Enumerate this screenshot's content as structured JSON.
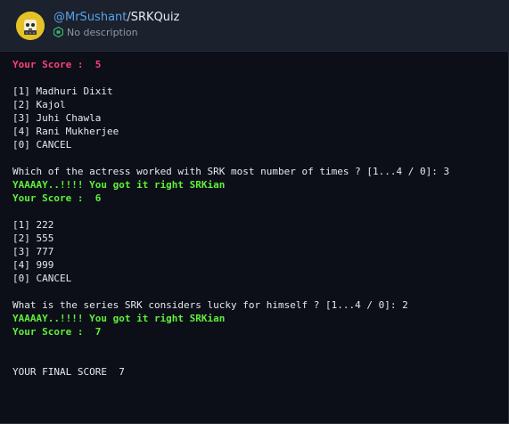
{
  "header": {
    "owner": "@MrSushant",
    "slash": "/",
    "repo": "SRKQuiz",
    "description": "No description",
    "avatar_icon": "robot-face-avatar",
    "repl_icon": "hexagon-repl-icon"
  },
  "colors": {
    "background": "#0c0f18",
    "header_bg": "#1b212d",
    "score_red": "#ff3f7a",
    "success_green": "#5ff03a",
    "link_blue": "#5aa0e8"
  },
  "console": {
    "score_line_1": "Your Score :  5",
    "options_1": [
      "[1] Madhuri Dixit",
      "[2] Kajol",
      "[3] Juhi Chawla",
      "[4] Rani Mukherjee",
      "[0] CANCEL"
    ],
    "question_1": "Which of the actress worked with SRK most number of times ? [1...4 / 0]: 3",
    "result_1": "YAAAAY..!!!! You got it right SRKian",
    "score_line_2": "Your Score :  6",
    "options_2": [
      "[1] 222",
      "[2] 555",
      "[3] 777",
      "[4] 999",
      "[0] CANCEL"
    ],
    "question_2": "What is the series SRK considers lucky for himself ? [1...4 / 0]: 2",
    "result_2": "YAAAAY..!!!! You got it right SRKian",
    "score_line_3": "Your Score :  7",
    "final_score": "YOUR FINAL SCORE  7"
  }
}
